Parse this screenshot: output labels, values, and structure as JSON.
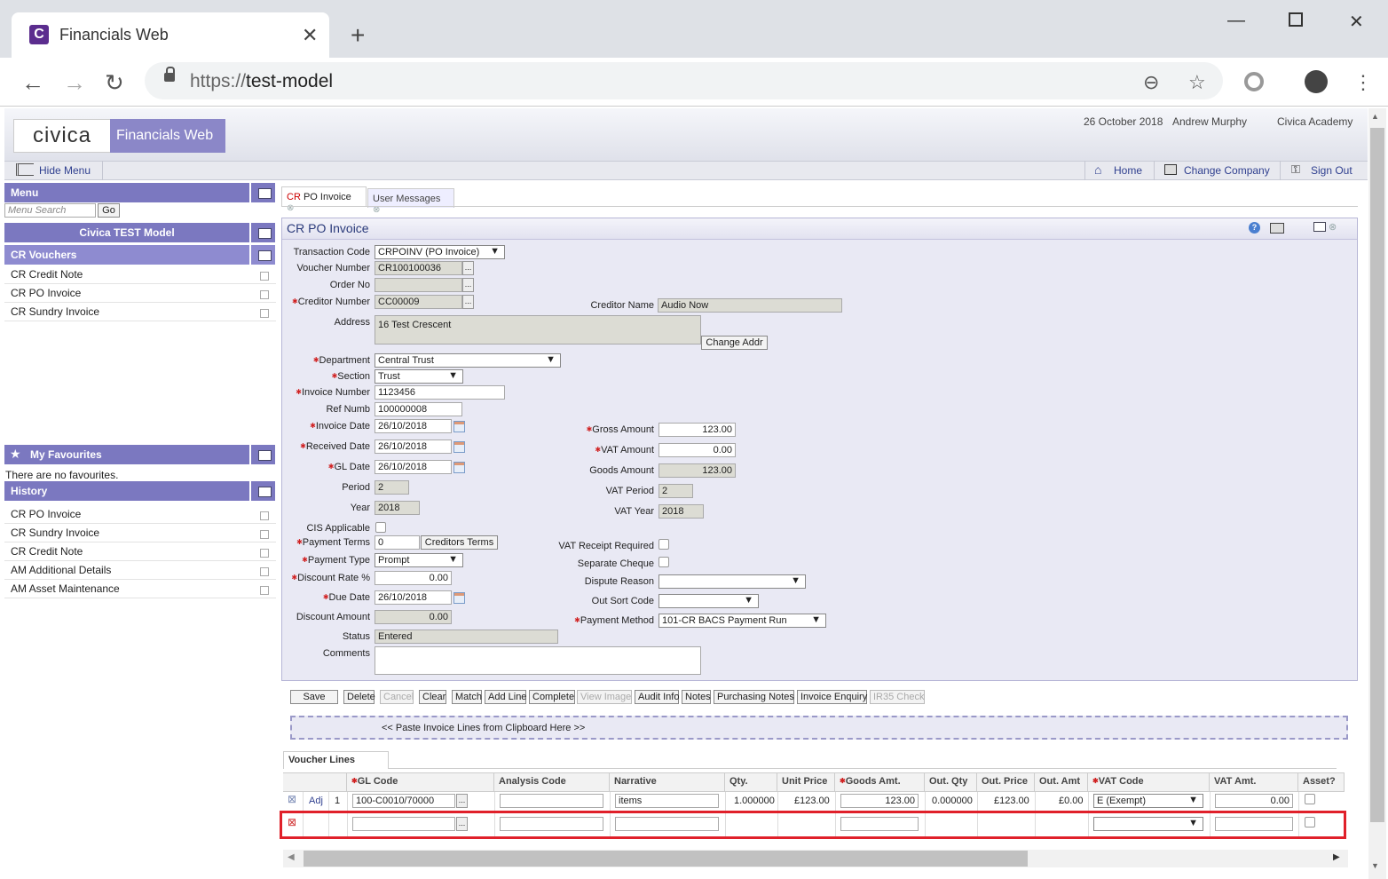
{
  "browser": {
    "tab_title": "Financials Web",
    "url_scheme": "https://",
    "url_host": "test-model",
    "favicon": "C"
  },
  "header": {
    "logo_text": "civica",
    "app_name": "Financials Web",
    "date": "26 October 2018",
    "user": "Andrew Murphy",
    "org": "Civica Academy"
  },
  "menubar": {
    "hide_menu": "Hide Menu",
    "home": "Home",
    "change_company": "Change Company",
    "sign_out": "Sign Out"
  },
  "sidebar": {
    "menu_title": "Menu",
    "search_placeholder": "Menu Search",
    "go": "Go",
    "model_title": "Civica TEST Model",
    "section_title": "CR Vouchers",
    "items": [
      "CR Credit Note",
      "CR PO Invoice",
      "CR Sundry Invoice"
    ],
    "favourites_title": "My Favourites",
    "favourites_empty": "There are no favourites.",
    "history_title": "History",
    "history": [
      "CR PO Invoice",
      "CR Sundry Invoice",
      "CR Credit Note",
      "AM Additional Details",
      "AM Asset Maintenance"
    ]
  },
  "tabs": [
    {
      "prefix": "CR",
      "label": "PO Invoice"
    },
    {
      "label": "User Messages"
    }
  ],
  "form": {
    "title": "CR PO Invoice",
    "transaction_code_label": "Transaction Code",
    "transaction_code": "CRPOINV (PO Invoice)",
    "voucher_number_label": "Voucher Number",
    "voucher_number": "CR100100036",
    "order_no_label": "Order No",
    "order_no": "",
    "creditor_number_label": "Creditor Number",
    "creditor_number": "CC00009",
    "creditor_name_label": "Creditor Name",
    "creditor_name": "Audio Now",
    "address_label": "Address",
    "address": "16 Test Crescent",
    "change_addr": "Change Addr",
    "department_label": "Department",
    "department": "Central Trust",
    "section_label": "Section",
    "section": "Trust",
    "invoice_number_label": "Invoice Number",
    "invoice_number": "1123456",
    "ref_numb_label": "Ref Numb",
    "ref_numb": "100000008",
    "invoice_date_label": "Invoice Date",
    "invoice_date": "26/10/2018",
    "received_date_label": "Received Date",
    "received_date": "26/10/2018",
    "gl_date_label": "GL Date",
    "gl_date": "26/10/2018",
    "period_label": "Period",
    "period": "2",
    "year_label": "Year",
    "year": "2018",
    "cis_label": "CIS Applicable",
    "payment_terms_label": "Payment Terms",
    "payment_terms": "0",
    "creditors_terms": "Creditors Terms",
    "payment_type_label": "Payment Type",
    "payment_type": "Prompt",
    "discount_rate_label": "Discount Rate %",
    "discount_rate": "0.00",
    "due_date_label": "Due Date",
    "due_date": "26/10/2018",
    "discount_amount_label": "Discount Amount",
    "discount_amount": "0.00",
    "status_label": "Status",
    "status": "Entered",
    "comments_label": "Comments",
    "comments": "",
    "gross_amount_label": "Gross Amount",
    "gross_amount": "123.00",
    "vat_amount_label": "VAT Amount",
    "vat_amount": "0.00",
    "goods_amount_label": "Goods Amount",
    "goods_amount": "123.00",
    "vat_period_label": "VAT Period",
    "vat_period": "2",
    "vat_year_label": "VAT Year",
    "vat_year": "2018",
    "vat_receipt_label": "VAT Receipt Required",
    "separate_cheque_label": "Separate Cheque",
    "dispute_reason_label": "Dispute Reason",
    "dispute_reason": "",
    "out_sort_code_label": "Out Sort Code",
    "out_sort_code": "",
    "payment_method_label": "Payment Method",
    "payment_method": "101-CR BACS Payment Run"
  },
  "actions": [
    "Save",
    "Delete",
    "Cancel",
    "Clear",
    "Match",
    "Add Line",
    "Complete",
    "View Image",
    "Audit Info",
    "Notes",
    "Purchasing Notes",
    "Invoice Enquiry",
    "IR35 Check"
  ],
  "paste_text": "<< Paste Invoice Lines from Clipboard Here >>",
  "lines": {
    "tab": "Voucher Lines",
    "columns": [
      "GL Code",
      "Analysis Code",
      "Narrative",
      "Qty.",
      "Unit Price",
      "Goods Amt.",
      "Out. Qty",
      "Out. Price",
      "Out. Amt",
      "VAT Code",
      "VAT Amt.",
      "Asset?"
    ],
    "row1": {
      "adj": "Adj",
      "num": "1",
      "gl_code": "100-C0010/70000",
      "analysis": "",
      "narrative": "items",
      "qty": "1.000000",
      "unit_price": "£123.00",
      "goods_amt": "123.00",
      "out_qty": "0.000000",
      "out_price": "£123.00",
      "out_amt": "£0.00",
      "vat_code": "E (Exempt)",
      "vat_amt": "0.00"
    }
  },
  "colors": {
    "accent": "#7b78c0",
    "highlight": "#e0202a",
    "required": "#d02020"
  }
}
